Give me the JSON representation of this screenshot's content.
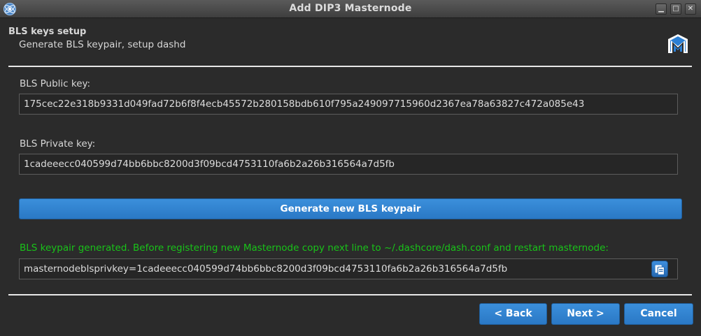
{
  "window": {
    "title": "Add DIP3 Masternode",
    "minimize_glyph": "▁",
    "maximize_glyph": "□",
    "close_glyph": "✕"
  },
  "header": {
    "title": "BLS keys setup",
    "subtitle": "Generate BLS keypair, setup dashd",
    "logo_icon": "dash-logo-icon"
  },
  "public_key": {
    "label": "BLS Public key:",
    "value": "175cec22e318b9331d049fad72b6f8f4ecb45572b280158bdb610f795a249097715960d2367ea78a63827c472a085e43"
  },
  "private_key": {
    "label": "BLS Private key:",
    "value": "1cadeeecc040599d74bb6bbc8200d3f09bcd4753110fa6b2a26b316564a7d5fb"
  },
  "generate_button": {
    "label": "Generate new BLS keypair"
  },
  "status_message": "BLS keypair generated. Before registering new Masternode copy next line to ~/.dashcore/dash.conf and restart masternode:",
  "config_line": {
    "value": "masternodeblsprivkey=1cadeeecc040599d74bb6bbc8200d3f09bcd4753110fa6b2a26b316564a7d5fb",
    "copy_icon": "copy-icon"
  },
  "footer": {
    "back_label": "< Back",
    "next_label": "Next >",
    "cancel_label": "Cancel"
  },
  "colors": {
    "accent": "#2a78c5",
    "status_green": "#19c319",
    "background": "#2b2b2b"
  }
}
